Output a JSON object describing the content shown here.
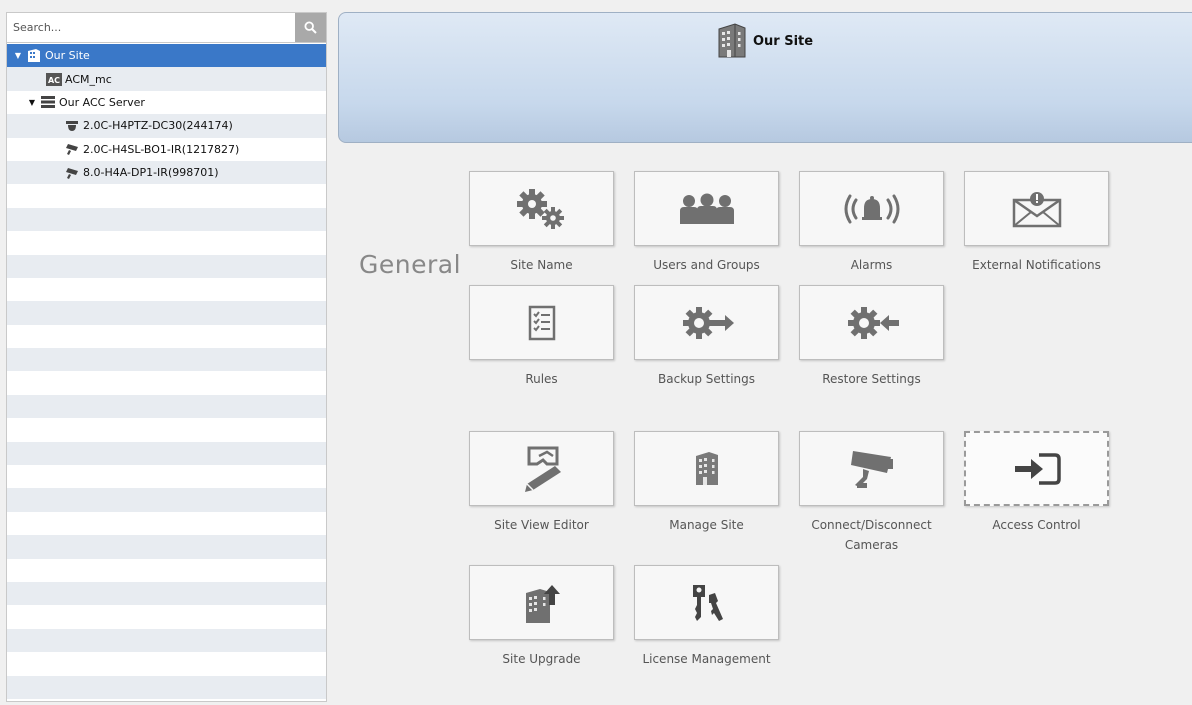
{
  "search": {
    "placeholder": "Search..."
  },
  "tree": [
    {
      "label": "Our Site",
      "icon": "building-icon",
      "twisty": "▼",
      "selected": true
    },
    {
      "label": "ACM_mc",
      "icon": "acm-icon",
      "twisty": "",
      "selected": false
    },
    {
      "label": "Our ACC Server",
      "icon": "server-icon",
      "twisty": "▼",
      "selected": false
    },
    {
      "label": "2.0C-H4PTZ-DC30(244174)",
      "icon": "ptz-camera-icon",
      "twisty": "",
      "selected": false
    },
    {
      "label": "2.0C-H4SL-BO1-IR(1217827)",
      "icon": "camera-icon",
      "twisty": "",
      "selected": false
    },
    {
      "label": "8.0-H4A-DP1-IR(998701)",
      "icon": "camera-icon",
      "twisty": "",
      "selected": false
    }
  ],
  "banner": {
    "title": "Our Site",
    "icon": "building-icon"
  },
  "section": {
    "general_label": "General"
  },
  "tiles": {
    "site_name": "Site Name",
    "users_groups": "Users and Groups",
    "alarms": "Alarms",
    "external_notifications": "External Notifications",
    "rules": "Rules",
    "backup_settings": "Backup Settings",
    "restore_settings": "Restore Settings",
    "site_view_editor": "Site View Editor",
    "manage_site": "Manage Site",
    "connect_disconnect_line1": "Connect/Disconnect",
    "connect_disconnect_line2": "Cameras",
    "access_control": "Access Control",
    "site_upgrade": "Site Upgrade",
    "license_management": "License Management"
  },
  "colors": {
    "selection": "#3a78c8",
    "icon_gray": "#707070",
    "banner_top": "#dfe9f5",
    "banner_bottom": "#b6c9e0"
  }
}
